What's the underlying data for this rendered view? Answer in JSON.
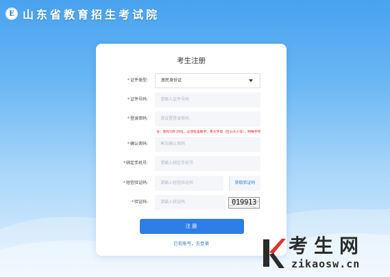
{
  "header": {
    "logo_char": "E",
    "site_title": "山东省教育招生考试院"
  },
  "form": {
    "title": "考生注册",
    "id_type": {
      "label": "证件类型:",
      "selected": "居民身份证"
    },
    "id_number": {
      "label": "证件号码:",
      "placeholder": "请输入证件号码"
    },
    "password": {
      "label": "登录密码:",
      "placeholder": "请设置登录密码",
      "hint": "注：密码为8-16位，必须包含数字、英文字母（区分大小写）、特殊字符"
    },
    "confirm_password": {
      "label": "确认密码:",
      "placeholder": "再次确认密码"
    },
    "phone": {
      "label": "绑定手机号:",
      "placeholder": "请输入绑定手机号"
    },
    "sms_code": {
      "label": "短信验证码:",
      "placeholder": "请输入短信验证码",
      "button": "获取验证码"
    },
    "captcha": {
      "label": "验证码:",
      "placeholder": "请输入验证码",
      "image_text": "019913"
    },
    "required_mark": "*",
    "submit_label": "注册",
    "login_link": "已有账号，去登录"
  },
  "watermark": {
    "brand_cn": "考生网",
    "brand_en": "zikaosw.cn"
  },
  "colors": {
    "primary": "#2d7ee6",
    "error": "#e02020",
    "link": "#2f7fd8"
  }
}
